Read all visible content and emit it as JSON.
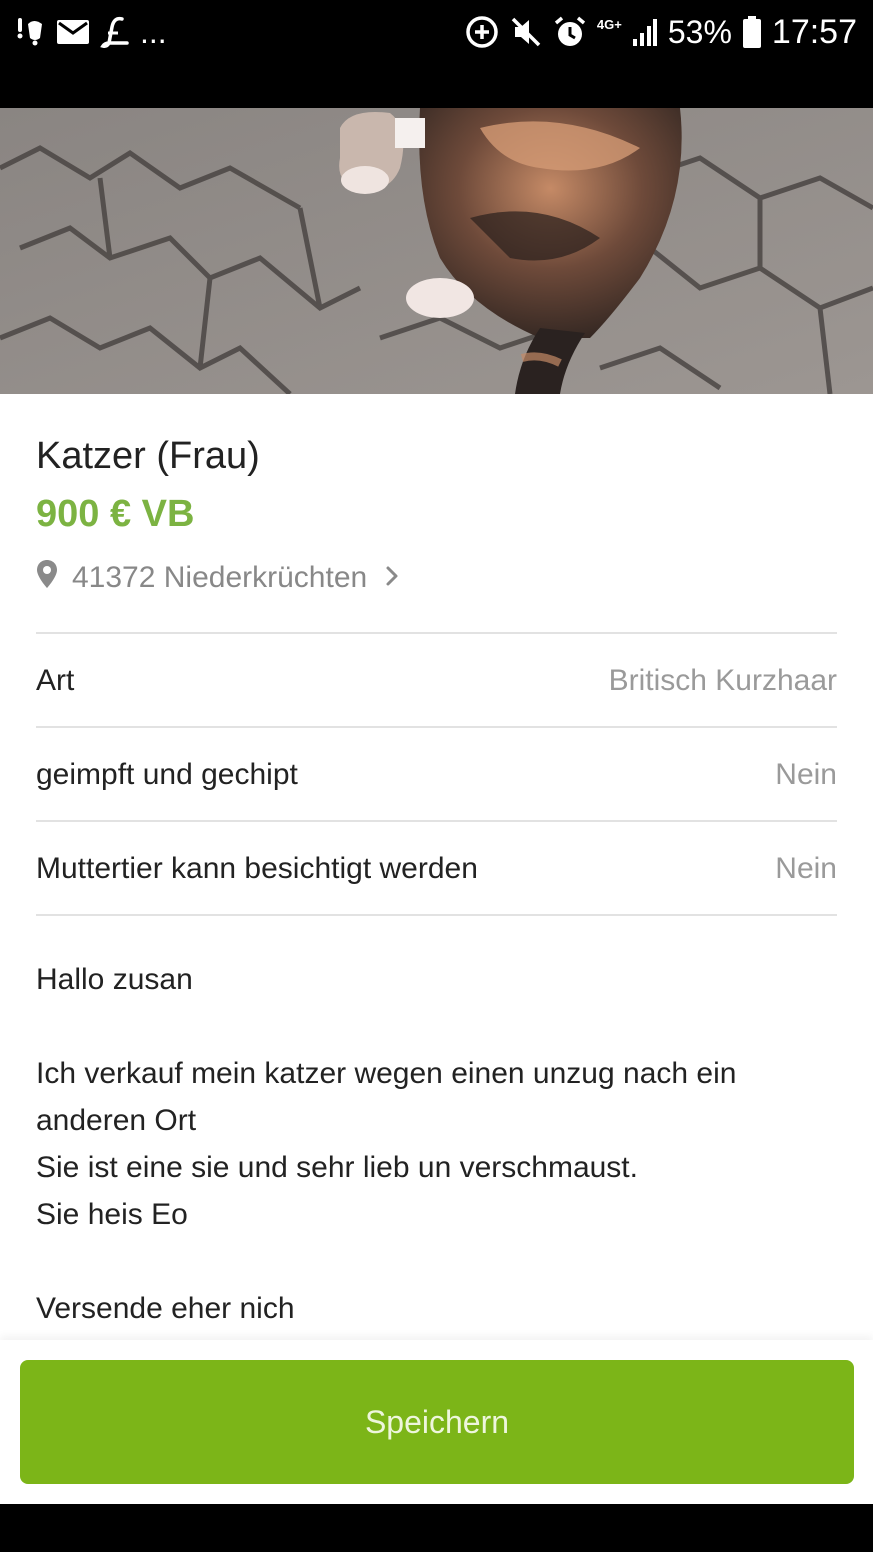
{
  "status_bar": {
    "left_icons": [
      "notification-alert-icon",
      "mail-icon",
      "script-l-icon"
    ],
    "overflow": "...",
    "right_icons": [
      "data-saver-icon",
      "mute-icon",
      "alarm-icon",
      "signal-icon",
      "battery-icon"
    ],
    "network": "4G+",
    "battery": "53%",
    "time": "17:57"
  },
  "listing": {
    "title": "Katzer (Frau)",
    "price": "900 € VB",
    "price_color": "#7cb342",
    "location": "41372 Niederkrüchten",
    "attributes": [
      {
        "label": "Art",
        "value": "Britisch Kurzhaar"
      },
      {
        "label": "geimpft und gechipt",
        "value": "Nein"
      },
      {
        "label": "Muttertier kann besichtigt werden",
        "value": "Nein"
      }
    ],
    "description": [
      "Hallo zusan",
      "",
      "Ich verkauf mein katzer wegen einen unzug nach ein",
      "anderen Ort",
      "Sie ist eine sie und sehr lieb un verschmaust.",
      "Sie heis Eo",
      "",
      "Versende eher nich"
    ]
  },
  "actions": {
    "save_label": "Speichern",
    "accent_color": "#7cb518"
  }
}
